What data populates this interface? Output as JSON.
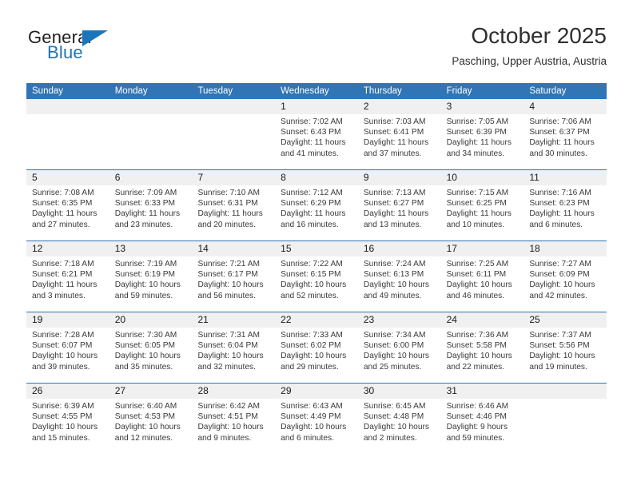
{
  "brand": {
    "name_part1": "General",
    "name_part2": "Blue",
    "colors": {
      "dark": "#231f20",
      "blue": "#1b75bb"
    }
  },
  "header": {
    "month_title": "October 2025",
    "location": "Pasching, Upper Austria, Austria"
  },
  "theme": {
    "header_blue": "#3075b5",
    "day_strip_gray": "#f0f0f0",
    "text": "#3a3a3a"
  },
  "calendar": {
    "weekdays": [
      "Sunday",
      "Monday",
      "Tuesday",
      "Wednesday",
      "Thursday",
      "Friday",
      "Saturday"
    ],
    "weeks": [
      [
        {
          "day": "",
          "lines": []
        },
        {
          "day": "",
          "lines": []
        },
        {
          "day": "",
          "lines": []
        },
        {
          "day": "1",
          "lines": [
            "Sunrise: 7:02 AM",
            "Sunset: 6:43 PM",
            "Daylight: 11 hours",
            "and 41 minutes."
          ]
        },
        {
          "day": "2",
          "lines": [
            "Sunrise: 7:03 AM",
            "Sunset: 6:41 PM",
            "Daylight: 11 hours",
            "and 37 minutes."
          ]
        },
        {
          "day": "3",
          "lines": [
            "Sunrise: 7:05 AM",
            "Sunset: 6:39 PM",
            "Daylight: 11 hours",
            "and 34 minutes."
          ]
        },
        {
          "day": "4",
          "lines": [
            "Sunrise: 7:06 AM",
            "Sunset: 6:37 PM",
            "Daylight: 11 hours",
            "and 30 minutes."
          ]
        }
      ],
      [
        {
          "day": "5",
          "lines": [
            "Sunrise: 7:08 AM",
            "Sunset: 6:35 PM",
            "Daylight: 11 hours",
            "and 27 minutes."
          ]
        },
        {
          "day": "6",
          "lines": [
            "Sunrise: 7:09 AM",
            "Sunset: 6:33 PM",
            "Daylight: 11 hours",
            "and 23 minutes."
          ]
        },
        {
          "day": "7",
          "lines": [
            "Sunrise: 7:10 AM",
            "Sunset: 6:31 PM",
            "Daylight: 11 hours",
            "and 20 minutes."
          ]
        },
        {
          "day": "8",
          "lines": [
            "Sunrise: 7:12 AM",
            "Sunset: 6:29 PM",
            "Daylight: 11 hours",
            "and 16 minutes."
          ]
        },
        {
          "day": "9",
          "lines": [
            "Sunrise: 7:13 AM",
            "Sunset: 6:27 PM",
            "Daylight: 11 hours",
            "and 13 minutes."
          ]
        },
        {
          "day": "10",
          "lines": [
            "Sunrise: 7:15 AM",
            "Sunset: 6:25 PM",
            "Daylight: 11 hours",
            "and 10 minutes."
          ]
        },
        {
          "day": "11",
          "lines": [
            "Sunrise: 7:16 AM",
            "Sunset: 6:23 PM",
            "Daylight: 11 hours",
            "and 6 minutes."
          ]
        }
      ],
      [
        {
          "day": "12",
          "lines": [
            "Sunrise: 7:18 AM",
            "Sunset: 6:21 PM",
            "Daylight: 11 hours",
            "and 3 minutes."
          ]
        },
        {
          "day": "13",
          "lines": [
            "Sunrise: 7:19 AM",
            "Sunset: 6:19 PM",
            "Daylight: 10 hours",
            "and 59 minutes."
          ]
        },
        {
          "day": "14",
          "lines": [
            "Sunrise: 7:21 AM",
            "Sunset: 6:17 PM",
            "Daylight: 10 hours",
            "and 56 minutes."
          ]
        },
        {
          "day": "15",
          "lines": [
            "Sunrise: 7:22 AM",
            "Sunset: 6:15 PM",
            "Daylight: 10 hours",
            "and 52 minutes."
          ]
        },
        {
          "day": "16",
          "lines": [
            "Sunrise: 7:24 AM",
            "Sunset: 6:13 PM",
            "Daylight: 10 hours",
            "and 49 minutes."
          ]
        },
        {
          "day": "17",
          "lines": [
            "Sunrise: 7:25 AM",
            "Sunset: 6:11 PM",
            "Daylight: 10 hours",
            "and 46 minutes."
          ]
        },
        {
          "day": "18",
          "lines": [
            "Sunrise: 7:27 AM",
            "Sunset: 6:09 PM",
            "Daylight: 10 hours",
            "and 42 minutes."
          ]
        }
      ],
      [
        {
          "day": "19",
          "lines": [
            "Sunrise: 7:28 AM",
            "Sunset: 6:07 PM",
            "Daylight: 10 hours",
            "and 39 minutes."
          ]
        },
        {
          "day": "20",
          "lines": [
            "Sunrise: 7:30 AM",
            "Sunset: 6:05 PM",
            "Daylight: 10 hours",
            "and 35 minutes."
          ]
        },
        {
          "day": "21",
          "lines": [
            "Sunrise: 7:31 AM",
            "Sunset: 6:04 PM",
            "Daylight: 10 hours",
            "and 32 minutes."
          ]
        },
        {
          "day": "22",
          "lines": [
            "Sunrise: 7:33 AM",
            "Sunset: 6:02 PM",
            "Daylight: 10 hours",
            "and 29 minutes."
          ]
        },
        {
          "day": "23",
          "lines": [
            "Sunrise: 7:34 AM",
            "Sunset: 6:00 PM",
            "Daylight: 10 hours",
            "and 25 minutes."
          ]
        },
        {
          "day": "24",
          "lines": [
            "Sunrise: 7:36 AM",
            "Sunset: 5:58 PM",
            "Daylight: 10 hours",
            "and 22 minutes."
          ]
        },
        {
          "day": "25",
          "lines": [
            "Sunrise: 7:37 AM",
            "Sunset: 5:56 PM",
            "Daylight: 10 hours",
            "and 19 minutes."
          ]
        }
      ],
      [
        {
          "day": "26",
          "lines": [
            "Sunrise: 6:39 AM",
            "Sunset: 4:55 PM",
            "Daylight: 10 hours",
            "and 15 minutes."
          ]
        },
        {
          "day": "27",
          "lines": [
            "Sunrise: 6:40 AM",
            "Sunset: 4:53 PM",
            "Daylight: 10 hours",
            "and 12 minutes."
          ]
        },
        {
          "day": "28",
          "lines": [
            "Sunrise: 6:42 AM",
            "Sunset: 4:51 PM",
            "Daylight: 10 hours",
            "and 9 minutes."
          ]
        },
        {
          "day": "29",
          "lines": [
            "Sunrise: 6:43 AM",
            "Sunset: 4:49 PM",
            "Daylight: 10 hours",
            "and 6 minutes."
          ]
        },
        {
          "day": "30",
          "lines": [
            "Sunrise: 6:45 AM",
            "Sunset: 4:48 PM",
            "Daylight: 10 hours",
            "and 2 minutes."
          ]
        },
        {
          "day": "31",
          "lines": [
            "Sunrise: 6:46 AM",
            "Sunset: 4:46 PM",
            "Daylight: 9 hours",
            "and 59 minutes."
          ]
        },
        {
          "day": "",
          "lines": []
        }
      ]
    ]
  }
}
